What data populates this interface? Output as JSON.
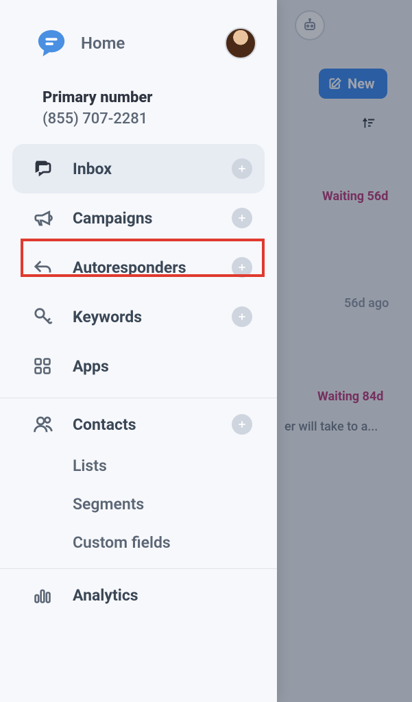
{
  "header": {
    "home_label": "Home"
  },
  "account": {
    "primary_title": "Primary number",
    "primary_phone": "(855) 707-2281"
  },
  "nav": {
    "inbox": "Inbox",
    "campaigns": "Campaigns",
    "autoresponders": "Autoresponders",
    "keywords": "Keywords",
    "apps": "Apps",
    "contacts": "Contacts",
    "lists": "Lists",
    "segments": "Segments",
    "custom_fields": "Custom fields",
    "analytics": "Analytics"
  },
  "main": {
    "new_button": "New",
    "waiting1": "Waiting 56d",
    "ago": "56d ago",
    "waiting2": "Waiting 84d",
    "truncated": "er will take to a..."
  },
  "highlight": "campaigns"
}
